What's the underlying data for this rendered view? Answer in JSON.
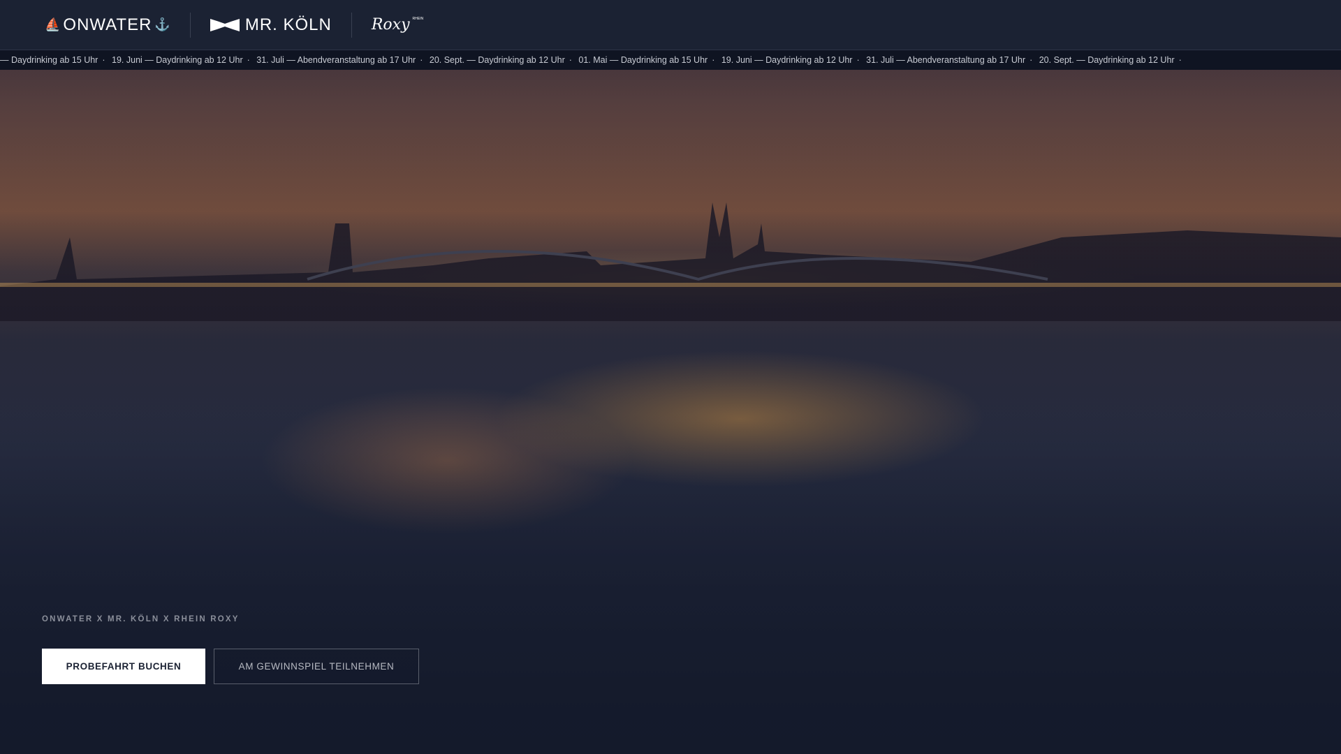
{
  "header": {
    "logos": [
      "ONWATER",
      "MR. KÖLN",
      "Roxy"
    ],
    "roxy_small": "RHEIN"
  },
  "ticker": [
    "— Daydrinking ab 15 Uhr",
    "19. Juni — Daydrinking ab 12 Uhr",
    "31. Juli — Abendveranstaltung ab 17 Uhr",
    "20. Sept. — Daydrinking ab 12 Uhr",
    "01. Mai — Daydrinking ab 15 Uhr",
    "19. Juni — Daydrinking ab 12 Uhr",
    "31. Juli — Abendveranstaltung ab 17 Uhr",
    "20. Sept. — Daydrinking ab 12 Uhr"
  ],
  "ticker_sep": "·",
  "hero": {
    "tagline": "ONWATER X MR. KÖLN X RHEIN ROXY",
    "primary_button": "PROBEFAHRT BUCHEN",
    "secondary_button": "AM GEWINNSPIEL TEILNEHMEN"
  }
}
